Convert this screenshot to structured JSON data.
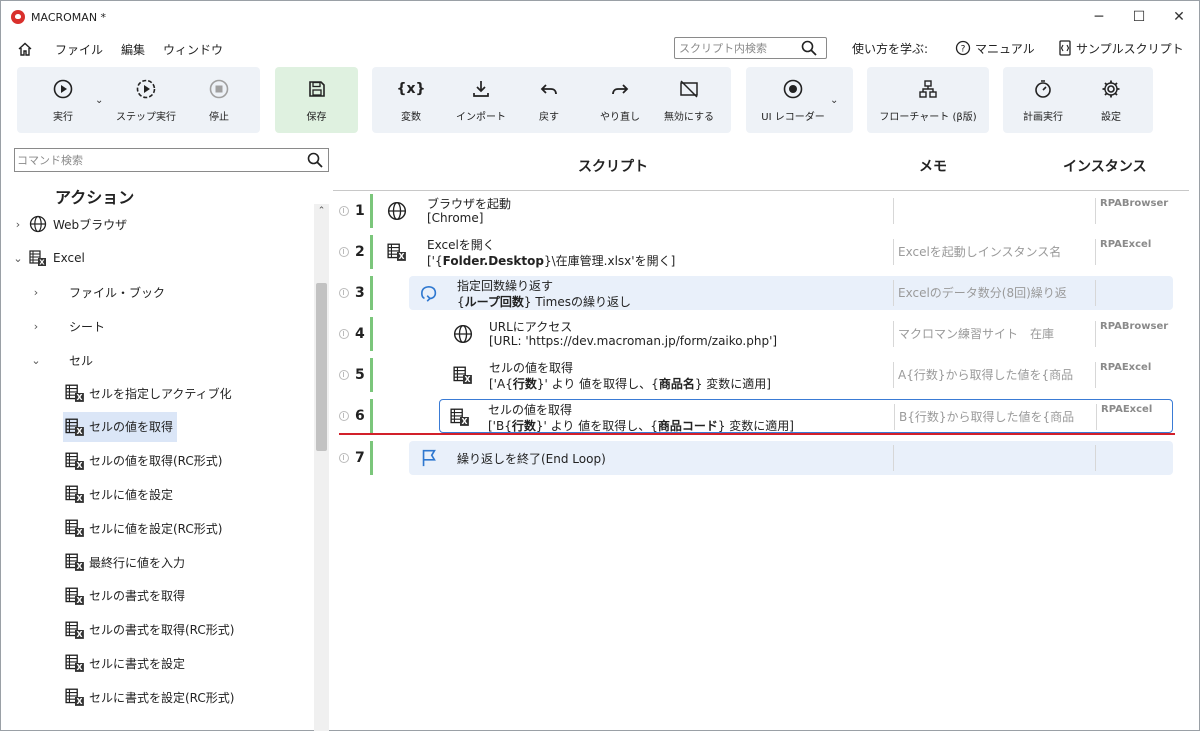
{
  "window": {
    "title": "MACROMAN *",
    "minimize": "─",
    "maximize": "☐",
    "close": "✕"
  },
  "menu": {
    "items": [
      "ファイル",
      "編集",
      "ウィンドウ"
    ]
  },
  "script_search": {
    "placeholder": "スクリプト内検索"
  },
  "help": {
    "learn": "使い方を学ぶ:",
    "manual": "マニュアル",
    "samples": "サンプルスクリプト"
  },
  "toolbar": {
    "run": "実行",
    "step_run": "ステップ実行",
    "stop": "停止",
    "save": "保存",
    "variables": "変数",
    "import": "インポート",
    "undo": "戻す",
    "redo": "やり直し",
    "disable": "無効にする",
    "ui_recorder": "UI レコーダー",
    "flowchart": "フローチャート (β版)",
    "schedule": "計画実行",
    "settings": "設定",
    "variables_glyph": "{x}"
  },
  "left": {
    "search_placeholder": "コマンド検索",
    "heading": "アクション",
    "tree": {
      "web": "Webブラウザ",
      "excel": "Excel",
      "file_book": "ファイル・ブック",
      "sheet": "シート",
      "cell": "セル"
    },
    "leaves": [
      "セルを指定しアクティブ化",
      "セルの値を取得",
      "セルの値を取得(RC形式)",
      "セルに値を設定",
      "セルに値を設定(RC形式)",
      "最終行に値を入力",
      "セルの書式を取得",
      "セルの書式を取得(RC形式)",
      "セルに書式を設定",
      "セルに書式を設定(RC形式)"
    ]
  },
  "script": {
    "headers": {
      "script": "スクリプト",
      "memo": "メモ",
      "instance": "インスタンス"
    },
    "rows": [
      {
        "num": "1",
        "title": "ブラウザを起動",
        "detail_a": "[Chrome]",
        "detail_b": "",
        "detail_c": "",
        "detail_d": "",
        "detail_e": "",
        "memo": "",
        "instance": "RPABrowser"
      },
      {
        "num": "2",
        "title": "Excelを開く",
        "detail_a": "['{",
        "detail_b": "Folder.Desktop",
        "detail_c": "}\\在庫管理.xlsx'を開く]",
        "detail_d": "",
        "detail_e": "",
        "memo": "Excelを起動しインスタンス名",
        "instance": "RPAExcel"
      },
      {
        "num": "3",
        "title": "指定回数繰り返す",
        "detail_a": "{",
        "detail_b": "ループ回数",
        "detail_c": "} Timesの繰り返し",
        "detail_d": "",
        "detail_e": "",
        "memo": "Excelのデータ数分(8回)繰り返",
        "instance": ""
      },
      {
        "num": "4",
        "title": "URLにアクセス",
        "detail_a": "[URL: 'https://dev.macroman.jp/form/zaiko.php']",
        "detail_b": "",
        "detail_c": "",
        "detail_d": "",
        "detail_e": "",
        "memo": "マクロマン練習サイト　在庫",
        "instance": "RPABrowser"
      },
      {
        "num": "5",
        "title": "セルの値を取得",
        "detail_a": "['A{",
        "detail_b": "行数",
        "detail_c": "}' より 値を取得し、{",
        "detail_d": "商品名",
        "detail_e": "} 変数に適用]",
        "memo": "A{行数}から取得した値を{商品",
        "instance": "RPAExcel"
      },
      {
        "num": "6",
        "title": "セルの値を取得",
        "detail_a": "['B{",
        "detail_b": "行数",
        "detail_c": "}' より 値を取得し、{",
        "detail_d": "商品コード",
        "detail_e": "} 変数に適用]",
        "memo": "B{行数}から取得した値を{商品",
        "instance": "RPAExcel"
      },
      {
        "num": "7",
        "title": "繰り返しを終了(End Loop)",
        "detail_a": "",
        "detail_b": "",
        "detail_c": "",
        "detail_d": "",
        "detail_e": "",
        "memo": "",
        "instance": ""
      }
    ]
  },
  "colors": {
    "accent": "#3a7bd5",
    "green_bar": "#7bc67b",
    "insert_line": "#d2202a",
    "toolbar_bg": "#eef2f7",
    "save_bg": "#dff1e0",
    "loop_bg": "#e9f0fa"
  }
}
